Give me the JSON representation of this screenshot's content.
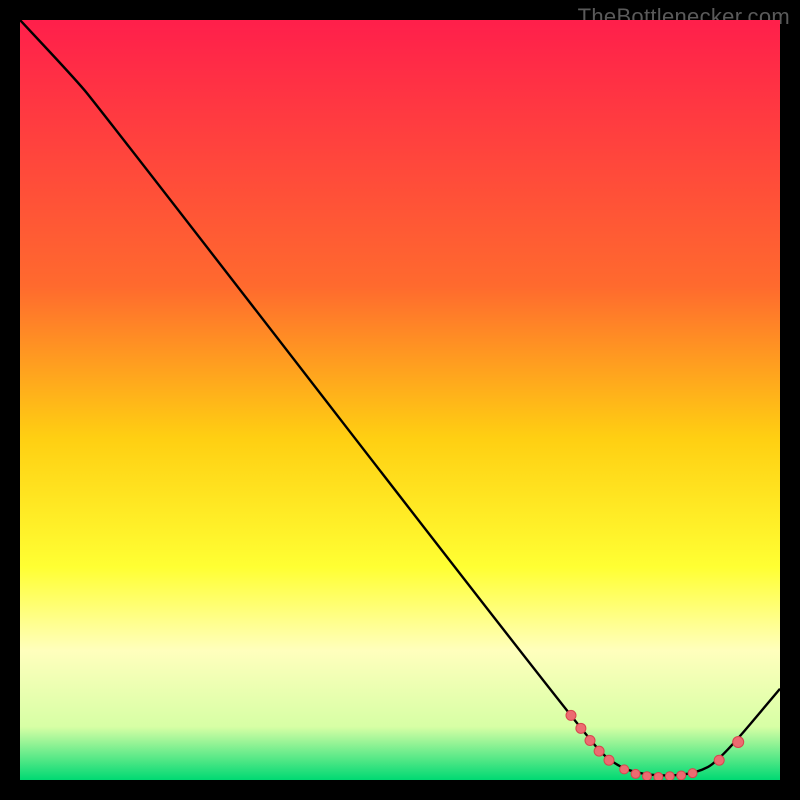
{
  "watermark": "TheBottlenecker.com",
  "chart_data": {
    "type": "line",
    "title": "",
    "xlabel": "",
    "ylabel": "",
    "xlim": [
      0,
      100
    ],
    "ylim": [
      0,
      100
    ],
    "gradient_stops": [
      {
        "offset": 0,
        "color": "#ff1f4b"
      },
      {
        "offset": 35,
        "color": "#ff6a2e"
      },
      {
        "offset": 55,
        "color": "#ffcf12"
      },
      {
        "offset": 72,
        "color": "#ffff33"
      },
      {
        "offset": 83,
        "color": "#ffffbd"
      },
      {
        "offset": 93,
        "color": "#d7ffa5"
      },
      {
        "offset": 100,
        "color": "#00d973"
      }
    ],
    "series": [
      {
        "name": "bottleneck-curve",
        "points": [
          {
            "x": 0,
            "y": 100
          },
          {
            "x": 7,
            "y": 92.5
          },
          {
            "x": 10,
            "y": 89
          },
          {
            "x": 75,
            "y": 5
          },
          {
            "x": 78,
            "y": 2.2
          },
          {
            "x": 81,
            "y": 0.9
          },
          {
            "x": 85,
            "y": 0.5
          },
          {
            "x": 89,
            "y": 0.9
          },
          {
            "x": 92,
            "y": 2.5
          },
          {
            "x": 100,
            "y": 12
          }
        ]
      }
    ],
    "markers": [
      {
        "x": 72.5,
        "y": 8.5,
        "r": 5
      },
      {
        "x": 73.8,
        "y": 6.8,
        "r": 5
      },
      {
        "x": 75.0,
        "y": 5.2,
        "r": 5
      },
      {
        "x": 76.2,
        "y": 3.8,
        "r": 5
      },
      {
        "x": 77.5,
        "y": 2.6,
        "r": 5
      },
      {
        "x": 79.5,
        "y": 1.4,
        "r": 4.5
      },
      {
        "x": 81.0,
        "y": 0.8,
        "r": 4.5
      },
      {
        "x": 82.5,
        "y": 0.5,
        "r": 4.5
      },
      {
        "x": 84.0,
        "y": 0.4,
        "r": 4.5
      },
      {
        "x": 85.5,
        "y": 0.5,
        "r": 4.5
      },
      {
        "x": 87.0,
        "y": 0.6,
        "r": 4.5
      },
      {
        "x": 88.5,
        "y": 0.9,
        "r": 4.5
      },
      {
        "x": 92.0,
        "y": 2.6,
        "r": 5
      },
      {
        "x": 94.5,
        "y": 5.0,
        "r": 5.5
      }
    ],
    "marker_style": {
      "fill": "#ec6b71",
      "stroke": "#d8454e"
    }
  }
}
